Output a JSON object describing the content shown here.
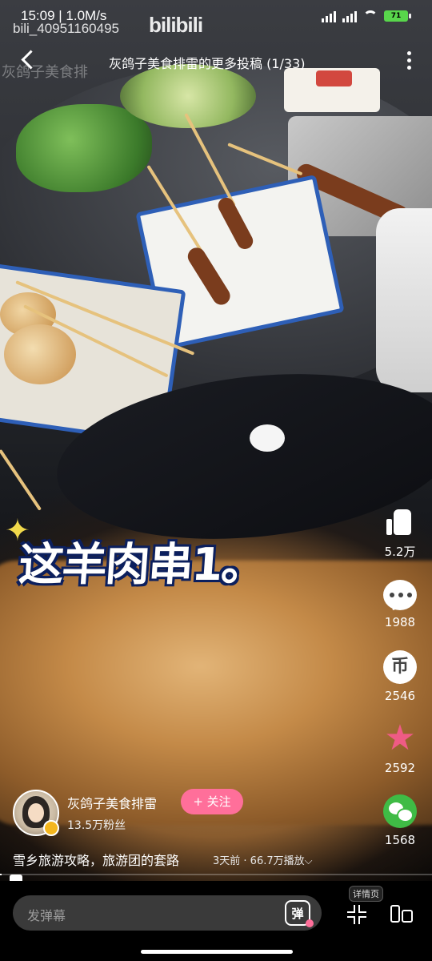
{
  "status_bar": {
    "time_speed": "15:09 | 1.0M/s",
    "battery": "71"
  },
  "watermark": {
    "user_id": "bili_40951160495",
    "logo": "bilibili"
  },
  "header": {
    "title": "灰鸽子美食排雷的更多投稿 (1/33)",
    "ghost_title": "灰鸽子美食排"
  },
  "caption": {
    "text": "这羊肉串1。"
  },
  "actions": {
    "like_count": "5.2万",
    "comment_count": "1988",
    "coin_count": "2546",
    "coin_glyph": "币",
    "favorite_count": "2592",
    "share_count": "1568"
  },
  "author": {
    "name": "灰鸽子美食排雷",
    "follow_label": "+ 关注",
    "fans": "13.5万粉丝"
  },
  "video": {
    "description": "雪乡旅游攻略，旅游团的套路",
    "meta": "3天前 · 66.7万播放⌵",
    "progress": 0
  },
  "bottom_bar": {
    "danmaku_placeholder": "发弹幕",
    "danmaku_button": "弹",
    "detail_tag": "详情页"
  },
  "colors": {
    "accent_pink": "#ff6f9a",
    "wechat_green": "#3fbb45",
    "star_pink": "#ef5b85"
  }
}
